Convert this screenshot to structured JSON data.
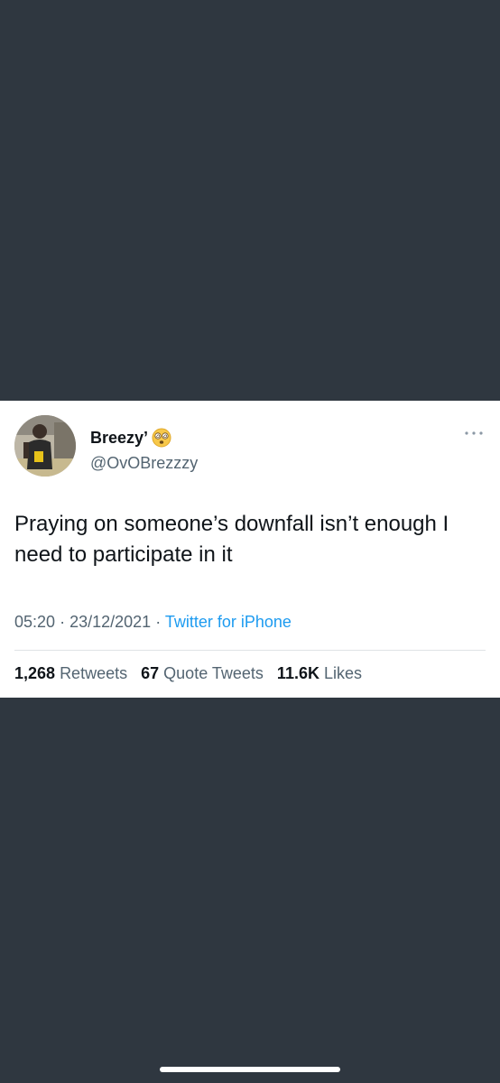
{
  "tweet": {
    "display_name": "Breezy’",
    "handle": "@OvOBrezzzy",
    "text": "Praying on someone’s downfall isn’t enough I need to participate in it",
    "time": "05:20",
    "date": "23/12/2021",
    "source": "Twitter for iPhone",
    "separator": "·",
    "retweets_count": "1,268",
    "retweets_label": "Retweets",
    "quotes_count": "67",
    "quotes_label": "Quote Tweets",
    "likes_count": "11.6K",
    "likes_label": "Likes"
  },
  "icons": {
    "avatar": "profile-photo",
    "emoji": "dizzy-face-emoji",
    "more": "more-dots-icon"
  },
  "colors": {
    "background": "#2f3740",
    "card": "#ffffff",
    "link": "#1d9bf0",
    "muted": "#536471",
    "text": "#0f1419"
  }
}
